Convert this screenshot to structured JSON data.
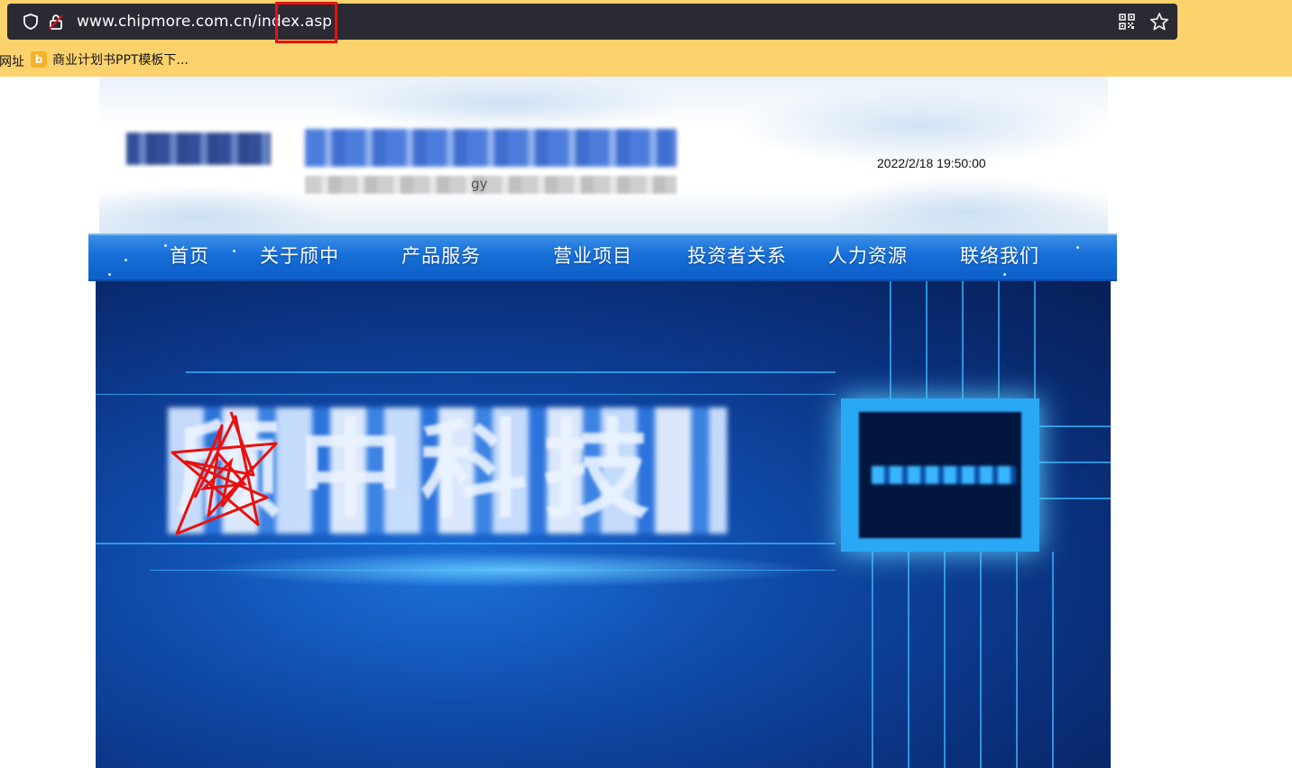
{
  "browser": {
    "url": "www.chipmore.com.cn/index.asp",
    "bookmarks": {
      "partial_item": "网址",
      "item": {
        "label": "商业计划书PPT模板下...",
        "favicon": "b"
      }
    }
  },
  "site": {
    "datetime": "2022/2/18 19:50:00",
    "subtitle_visible_fragment": "gy",
    "nav": [
      "首页",
      "关于颀中",
      "产品服务",
      "营业项目",
      "投资者关系",
      "人力资源",
      "联络我们"
    ],
    "banner_title": "颀中科技"
  },
  "colors": {
    "bookmark_bar": "#fbd26b",
    "urlbar_bg": "#2b2a33",
    "nav_blue": "#166fd8",
    "highlight_red": "#e8110f"
  },
  "icons": [
    "shield-icon",
    "lock-icon",
    "qr-code-icon",
    "star-icon",
    "bookmark-favicon"
  ]
}
